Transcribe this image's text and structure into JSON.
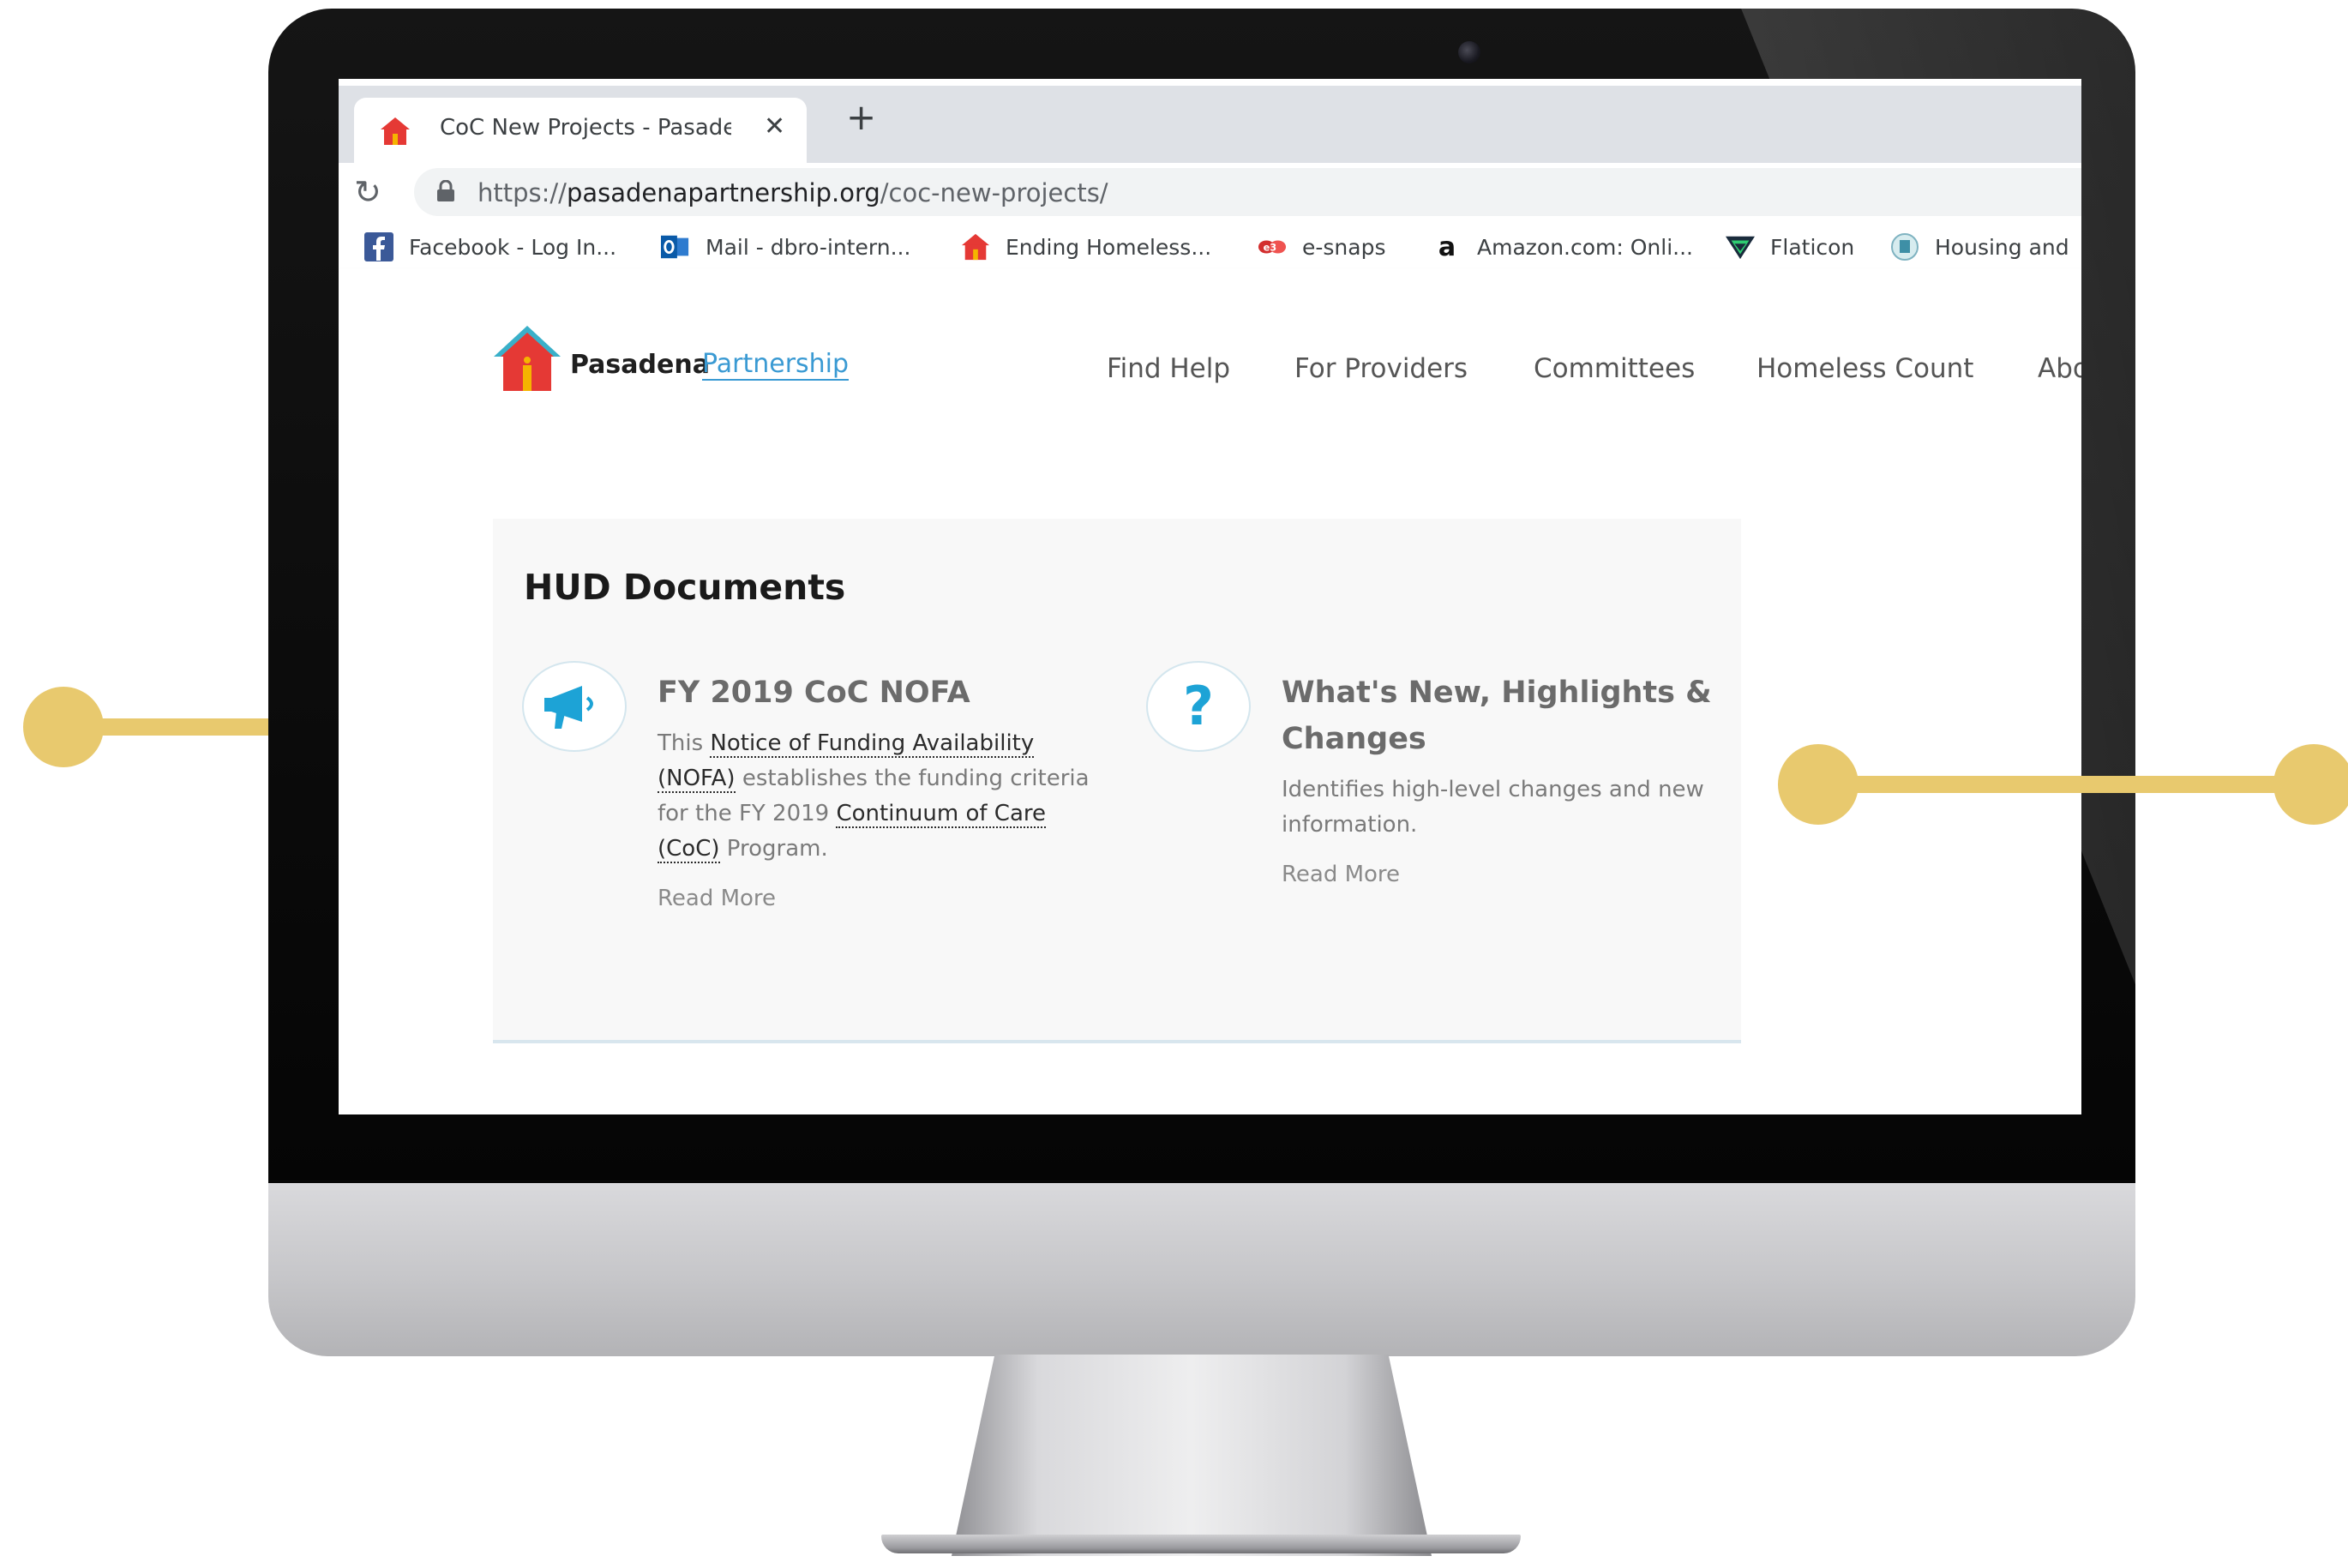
{
  "browser": {
    "tab_title": "CoC New Projects - Pasadena Partnership",
    "new_tab_icon": "plus-icon",
    "close_icon": "close-icon",
    "reload_icon": "reload-icon",
    "lock_icon": "lock-icon",
    "url_scheme": "https://",
    "url_domain": "pasadenapartnership.org",
    "url_path": "/coc-new-projects/",
    "bookmarks": [
      {
        "label": "Facebook - Log In...",
        "icon": "facebook-icon"
      },
      {
        "label": "Mail - dbro-intern...",
        "icon": "outlook-icon"
      },
      {
        "label": "Ending Homeless...",
        "icon": "house-icon"
      },
      {
        "label": "e-snaps",
        "icon": "esnaps-icon"
      },
      {
        "label": "Amazon.com: Onli...",
        "icon": "amazon-icon"
      },
      {
        "label": "Flaticon",
        "icon": "flaticon-icon"
      },
      {
        "label": "Housing and",
        "icon": "hud-seal-icon"
      }
    ]
  },
  "site": {
    "logo_word1": "Pasadena",
    "logo_word2": "Partnership",
    "nav": [
      "Find Help",
      "For Providers",
      "Committees",
      "Homeless Count",
      "About"
    ]
  },
  "hud": {
    "heading": "HUD Documents",
    "items": [
      {
        "icon": "megaphone-icon",
        "title": "FY 2019 CoC NOFA",
        "desc_pre": "This ",
        "link1": "Notice of Funding Availability (NOFA)",
        "desc_mid": " establishes the funding criteria for the FY 2019 ",
        "link2": "Continuum of Care (CoC)",
        "desc_post": " Program.",
        "read_more": "Read More"
      },
      {
        "icon": "question-mark-icon",
        "title": "What's New, Highlights & Changes",
        "desc": "Identifies high-level changes and new information.",
        "read_more": "Read More"
      }
    ]
  },
  "colors": {
    "accent_yellow": "#e8c96e",
    "link_blue": "#3a9ad3",
    "icon_blue": "#1da3d6",
    "logo_red": "#e53935"
  }
}
